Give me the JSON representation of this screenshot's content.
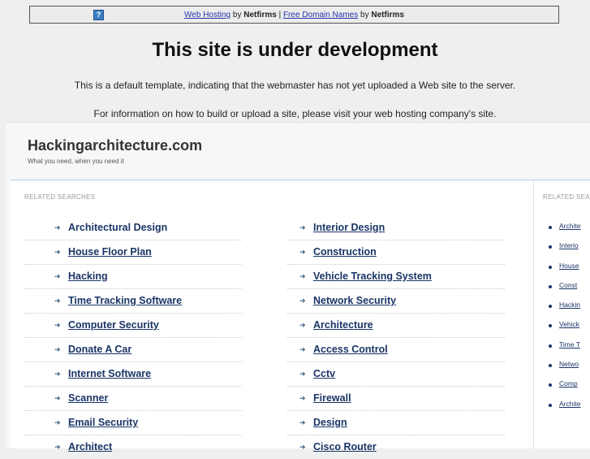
{
  "topbar": {
    "help_icon": "?",
    "web_hosting": "Web Hosting",
    "by1": "by",
    "brand1": "Netfirms",
    "sep": "|",
    "free_domains": "Free Domain Names",
    "by2": "by",
    "brand2": "Netfirms"
  },
  "notice": {
    "title": "This site is under development",
    "line1": "This is a default template, indicating that the webmaster has not yet uploaded a Web site to the server.",
    "line2": "For information on how to build or upload a site, please visit your web hosting company's site."
  },
  "parked": {
    "site_name": "Hackingarchitecture.com",
    "tagline": "What you need, when you need it",
    "header_dash": "-",
    "related_label": "RELATED SEARCHES",
    "side_label": "RELATED SEA",
    "left_items": [
      "Architectural Design",
      "House Floor Plan",
      "Hacking",
      "Time Tracking Software",
      "Computer Security",
      "Donate A Car",
      "Internet Software",
      "Scanner",
      "Email Security",
      "Architect"
    ],
    "right_items": [
      "Interior Design",
      "Construction",
      "Vehicle Tracking System",
      "Network Security",
      "Architecture",
      "Access Control",
      "Cctv",
      "Firewall",
      "Design",
      "Cisco Router"
    ],
    "side_items": [
      "Archite",
      "Interio",
      "House",
      "Const",
      "Hackin",
      "Vehick",
      "Time T",
      "Netwo",
      "Comp",
      "Archite"
    ]
  }
}
